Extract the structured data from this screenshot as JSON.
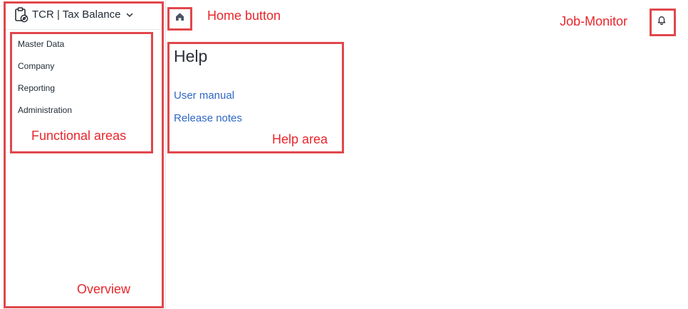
{
  "app": {
    "title": "TCR | Tax Balance",
    "icon": "clipboard-gear-icon"
  },
  "sidebar": {
    "items": [
      {
        "label": "Master Data"
      },
      {
        "label": "Company"
      },
      {
        "label": "Reporting"
      },
      {
        "label": "Administration"
      }
    ]
  },
  "toolbar": {
    "home_icon": "home-icon",
    "bell_icon": "bell-icon"
  },
  "help": {
    "title": "Help",
    "links": [
      {
        "label": "User manual"
      },
      {
        "label": "Release notes"
      }
    ]
  },
  "annotations": {
    "home_button": "Home button",
    "job_monitor": "Job-Monitor",
    "help_area": "Help area",
    "functional_areas": "Functional areas",
    "overview": "Overview",
    "color": "#e0474c"
  }
}
